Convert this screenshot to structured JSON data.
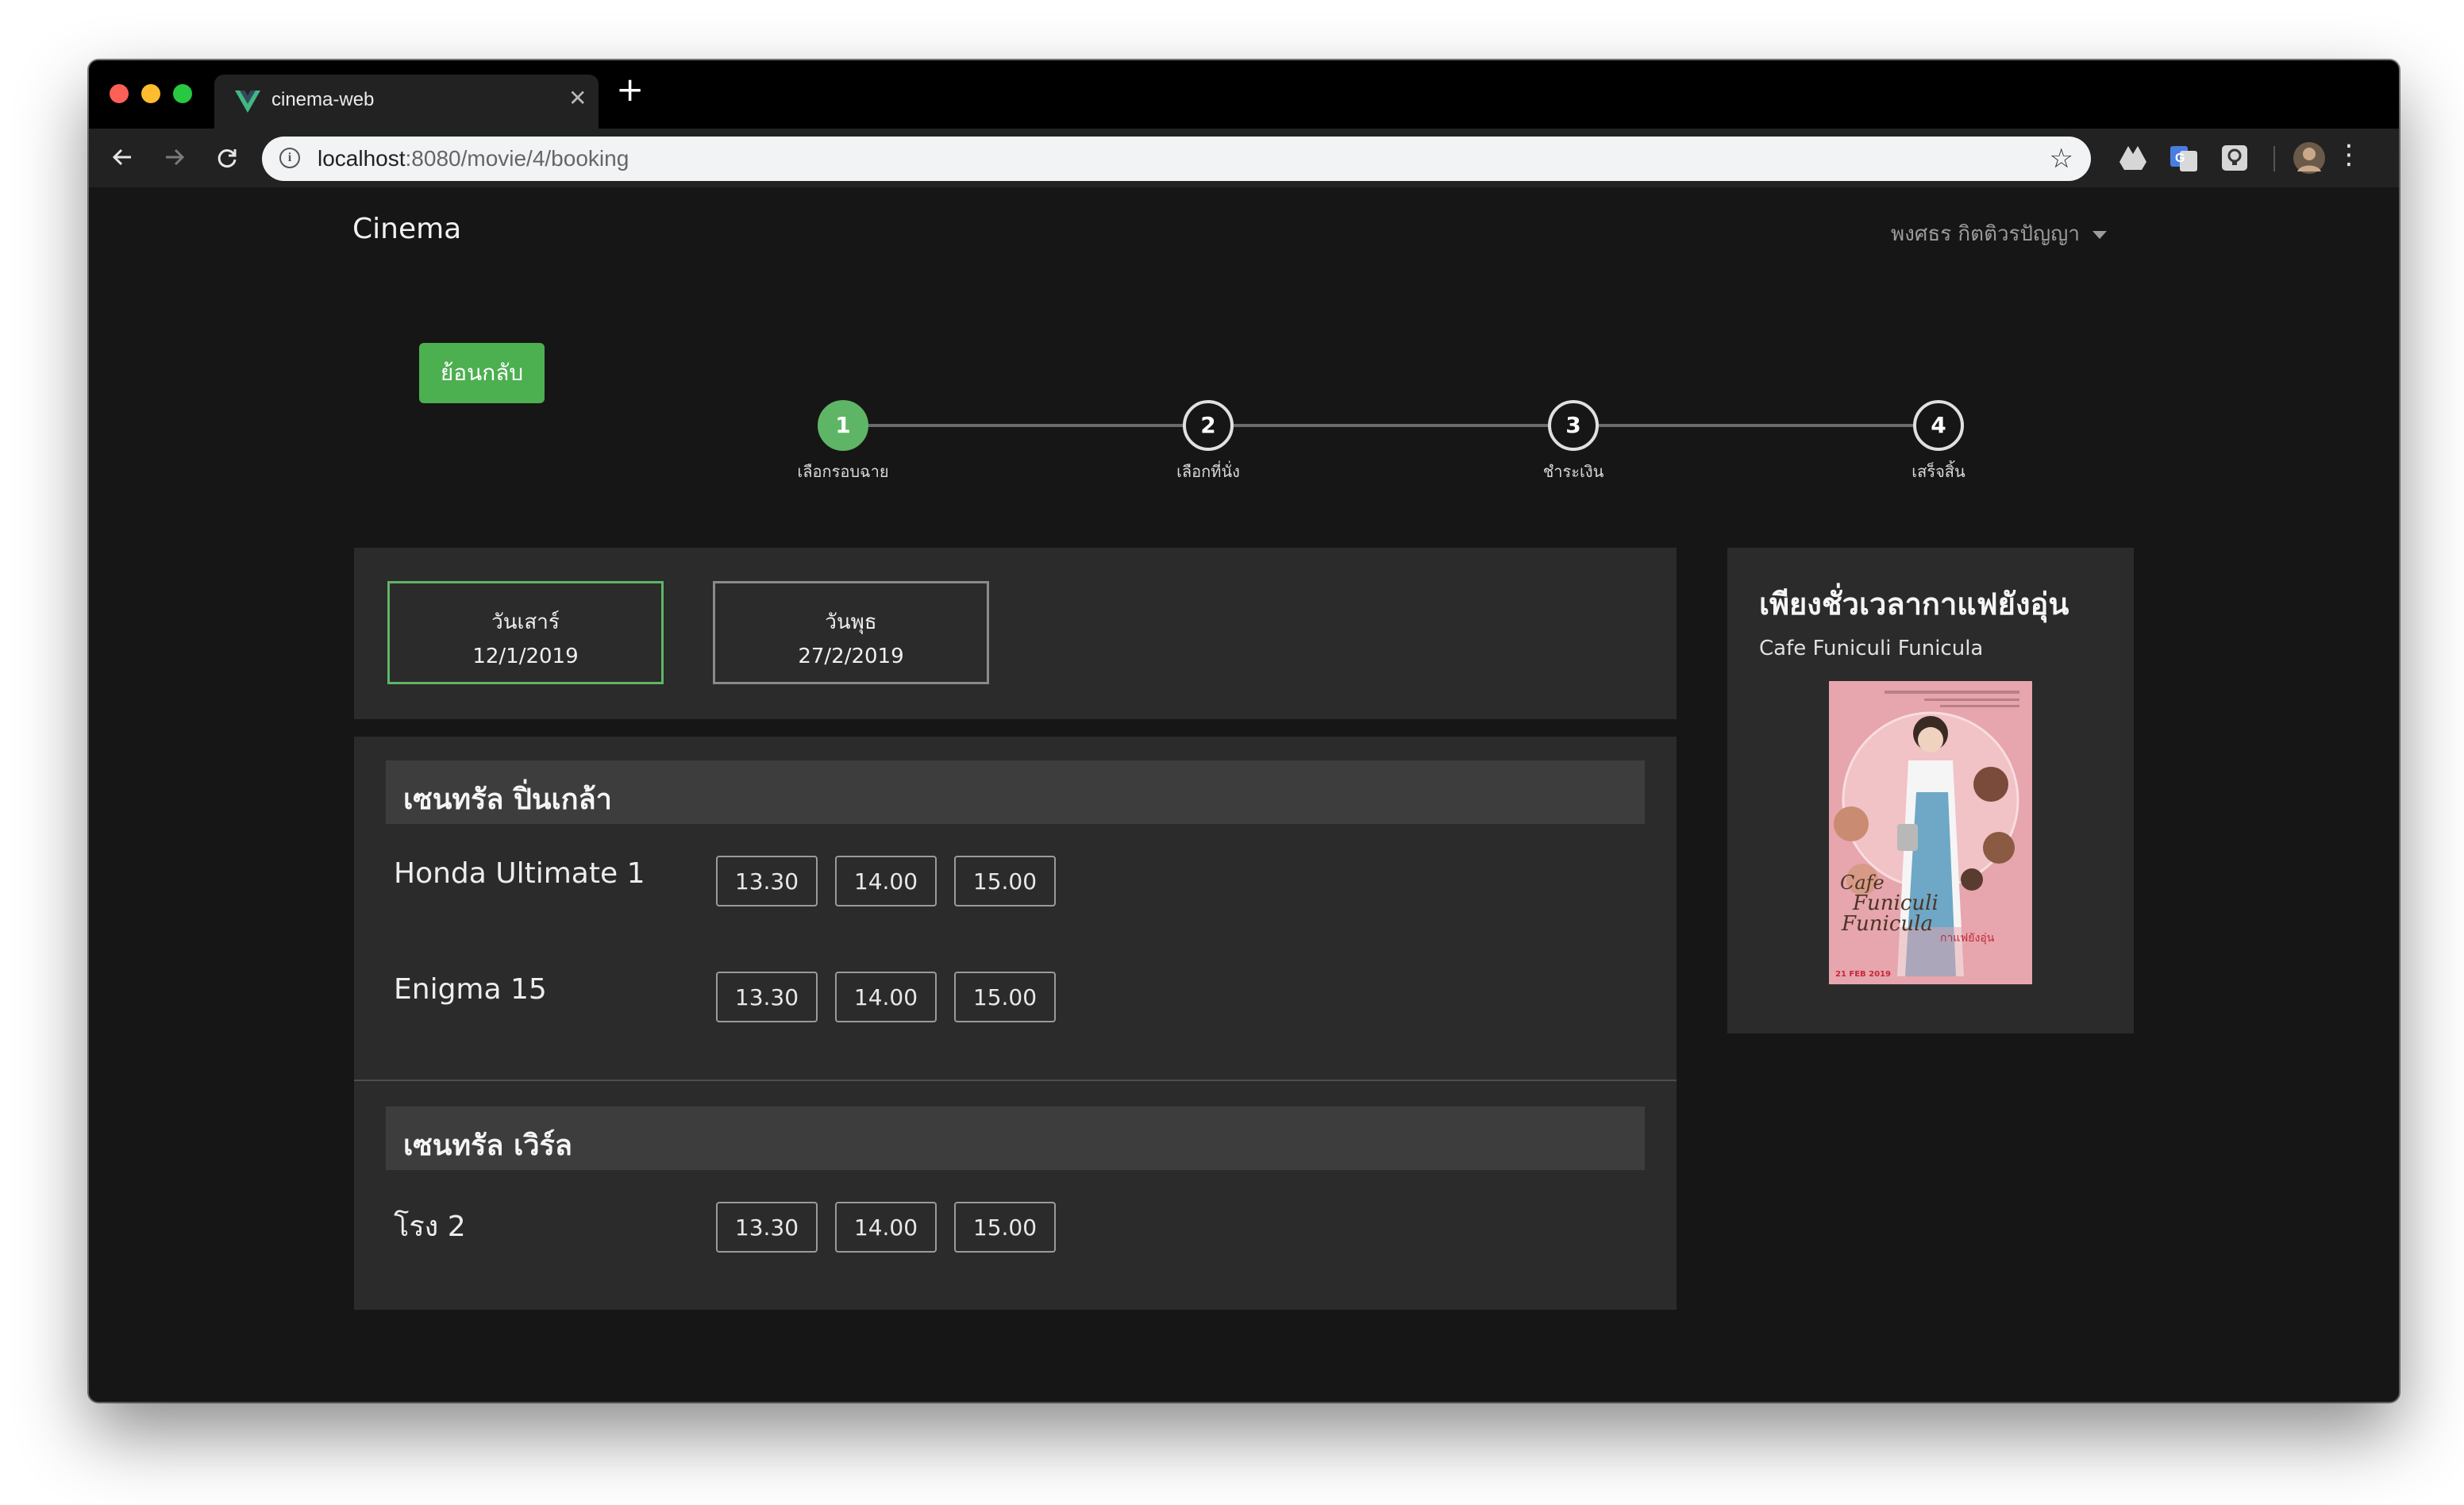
{
  "browser": {
    "tab_title": "cinema-web",
    "url_host": "localhost",
    "url_path": ":8080/movie/4/booking"
  },
  "header": {
    "brand": "Cinema",
    "user_name": "พงศธร กิตติวรปัญญา"
  },
  "back_label": "ย้อนกลับ",
  "steps": [
    {
      "number": "1",
      "label": "เลือกรอบฉาย",
      "active": true
    },
    {
      "number": "2",
      "label": "เลือกที่นั่ง",
      "active": false
    },
    {
      "number": "3",
      "label": "ชำระเงิน",
      "active": false
    },
    {
      "number": "4",
      "label": "เสร็จสิ้น",
      "active": false
    }
  ],
  "dates": [
    {
      "day": "วันเสาร์",
      "date": "12/1/2019",
      "selected": true
    },
    {
      "day": "วันพุธ",
      "date": "27/2/2019",
      "selected": false
    }
  ],
  "cinemas": [
    {
      "name": "เซนทรัล ปิ่นเกล้า",
      "halls": [
        {
          "name": "Honda Ultimate 1",
          "times": [
            "13.30",
            "14.00",
            "15.00"
          ]
        },
        {
          "name": "Enigma 15",
          "times": [
            "13.30",
            "14.00",
            "15.00"
          ]
        }
      ]
    },
    {
      "name": "เซนทรัล เวิร์ล",
      "halls": [
        {
          "name": "โรง 2",
          "times": [
            "13.30",
            "14.00",
            "15.00"
          ]
        }
      ]
    }
  ],
  "movie": {
    "title_th": "เพียงชั่วเวลากาแฟยังอุ่น",
    "title_en": "Cafe Funiculi Funicula",
    "poster_text_top": "Cafe",
    "poster_text_mid": "Funiculi",
    "poster_text_bot": "Funicula",
    "poster_text_th": "กาแฟยังอุ่น",
    "poster_date": "21 FEB 2019"
  },
  "colors": {
    "accent": "#4caf50",
    "page_bg": "#161616",
    "panel_bg": "#2b2b2b"
  }
}
